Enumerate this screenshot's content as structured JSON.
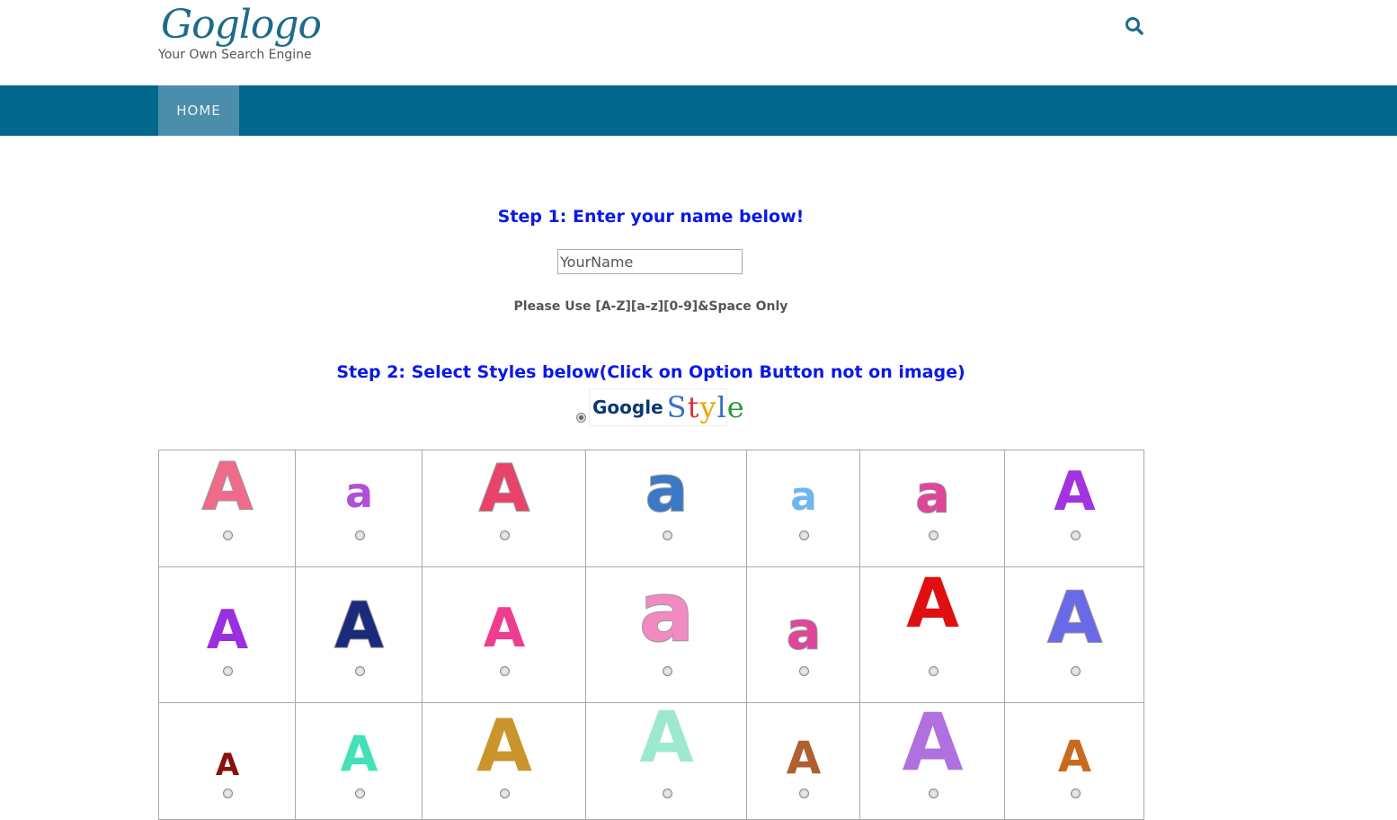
{
  "header": {
    "logo": "Goglogo",
    "tagline": "Your Own Search Engine",
    "search_icon": "search-icon"
  },
  "nav": {
    "items": [
      {
        "label": "HOME",
        "active": true
      }
    ]
  },
  "colors": {
    "nav_bar": "#02678c",
    "nav_active": "#4b8eab",
    "step_text": "#0a19e6",
    "logo": "#1e6b8a"
  },
  "form": {
    "step1": "Step 1: Enter your name below!",
    "name_value": "",
    "name_placeholder": "YourName",
    "hint": "Please Use [A-Z][a-z][0-9]&Space Only",
    "step2": "Step 2: Select Styles below(Click on Option Button not on image)",
    "google_style": {
      "word1": "Google",
      "word2": "Style",
      "selected": true
    }
  },
  "styles": [
    {
      "glyph": "A",
      "desc": "pink-orange glitter A"
    },
    {
      "glyph": "a",
      "desc": "purple glitter a with heart"
    },
    {
      "glyph": "A",
      "desc": "pink sketch A"
    },
    {
      "glyph": "a",
      "desc": "blue gothic a"
    },
    {
      "glyph": "a",
      "desc": "light blue a"
    },
    {
      "glyph": "a",
      "desc": "pink black-outline a"
    },
    {
      "glyph": "A",
      "desc": "purple block A"
    },
    {
      "glyph": "A",
      "desc": "purple glitter A"
    },
    {
      "glyph": "A",
      "desc": "navy snowy A"
    },
    {
      "glyph": "A",
      "desc": "pink block A"
    },
    {
      "glyph": "a",
      "desc": "pink glitter a with heart"
    },
    {
      "glyph": "a",
      "desc": "pink dark-outline a"
    },
    {
      "glyph": "A",
      "desc": "red dripping A"
    },
    {
      "glyph": "A",
      "desc": "rainbow glitter A"
    },
    {
      "glyph": "A",
      "desc": "small dark red A"
    },
    {
      "glyph": "A",
      "desc": "mint A"
    },
    {
      "glyph": "A",
      "desc": "gold A"
    },
    {
      "glyph": "A",
      "desc": "angel mint A"
    },
    {
      "glyph": "A",
      "desc": "atom A"
    },
    {
      "glyph": "A",
      "desc": "purple bubble A"
    },
    {
      "glyph": "A",
      "desc": "bell A"
    }
  ]
}
